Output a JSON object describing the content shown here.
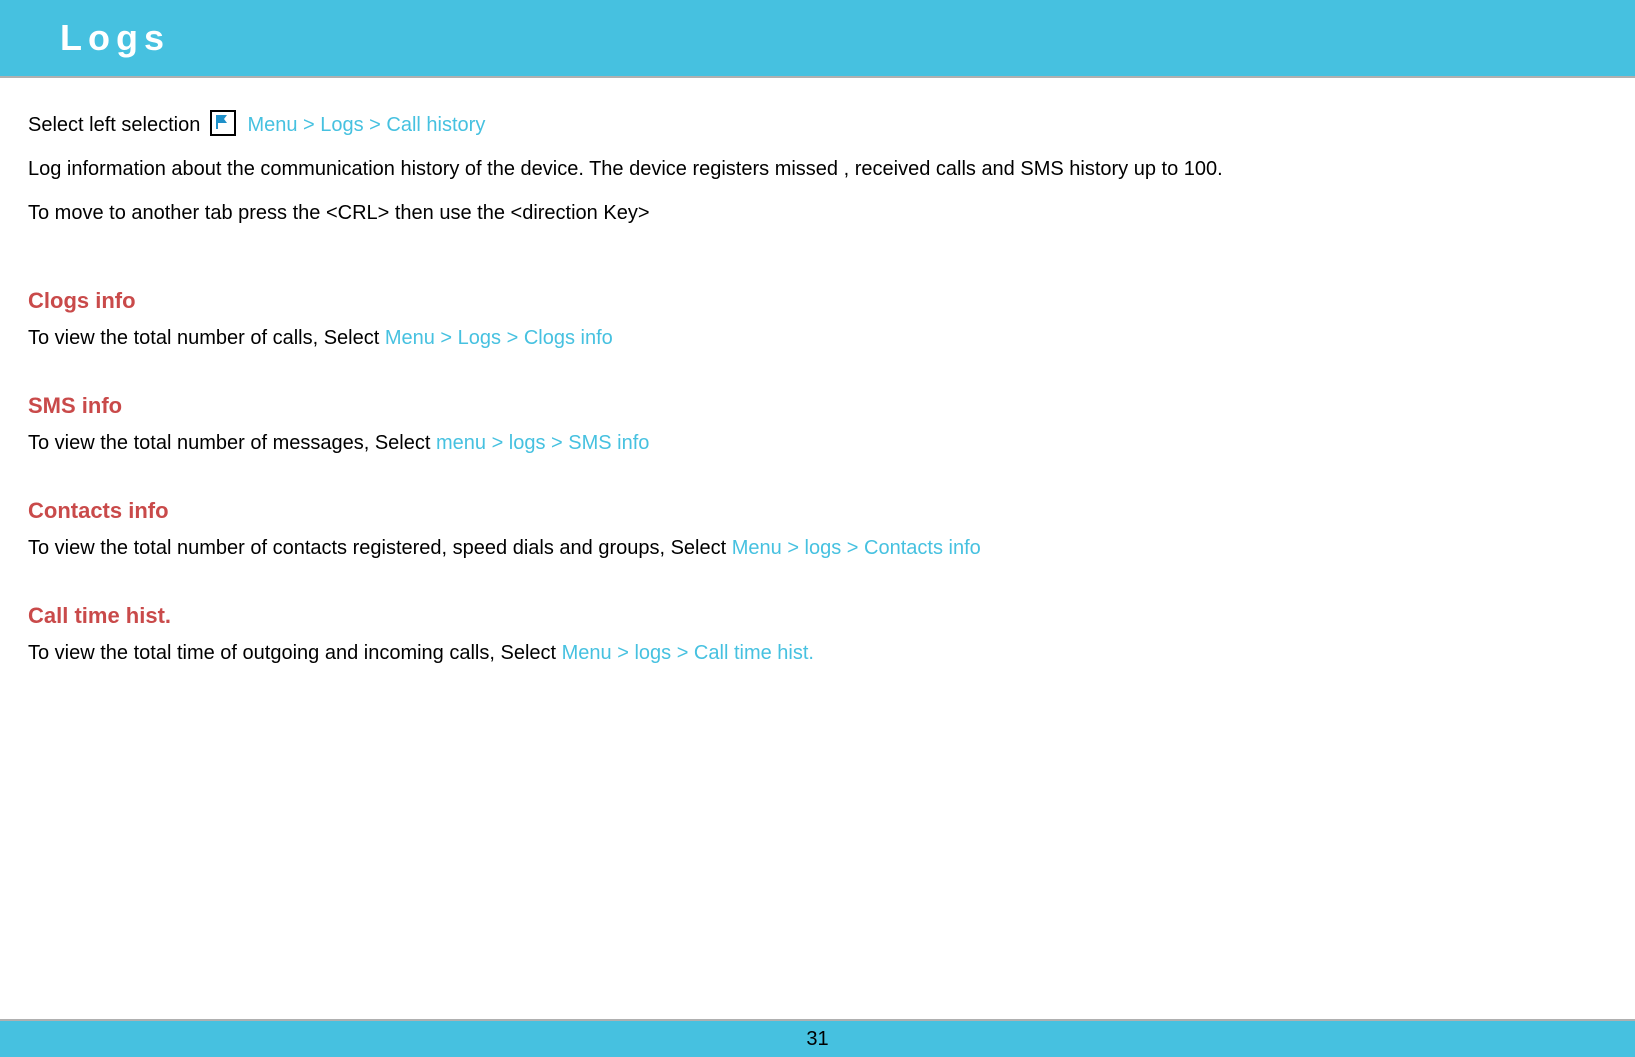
{
  "header": {
    "title": "Logs"
  },
  "intro": {
    "para1_prefix": "Select left selection ",
    "para1_link": " Menu > Logs > Call history",
    "para2": "Log information about the communication history of the device. The device registers missed , received calls and SMS history up to 100.",
    "para3": "To move to another tab press the <CRL> then use the <direction Key>"
  },
  "sections": {
    "clogs": {
      "heading": "Clogs info",
      "body_prefix": "To view the total number of calls, Select ",
      "body_link": "Menu > Logs > Clogs info"
    },
    "sms": {
      "heading": "SMS info",
      "body_prefix": "To view the total number of messages, Select ",
      "body_link": "menu > logs > SMS info"
    },
    "contacts": {
      "heading": "Contacts info",
      "body_prefix": "To view the total number of contacts registered, speed dials and groups, Select ",
      "body_link": "Menu > logs > Contacts info"
    },
    "calltime": {
      "heading": "Call time hist.",
      "body_prefix": "To view the total time of outgoing and incoming calls, Select ",
      "body_link": "Menu > logs > Call time hist."
    }
  },
  "page_number": "31"
}
